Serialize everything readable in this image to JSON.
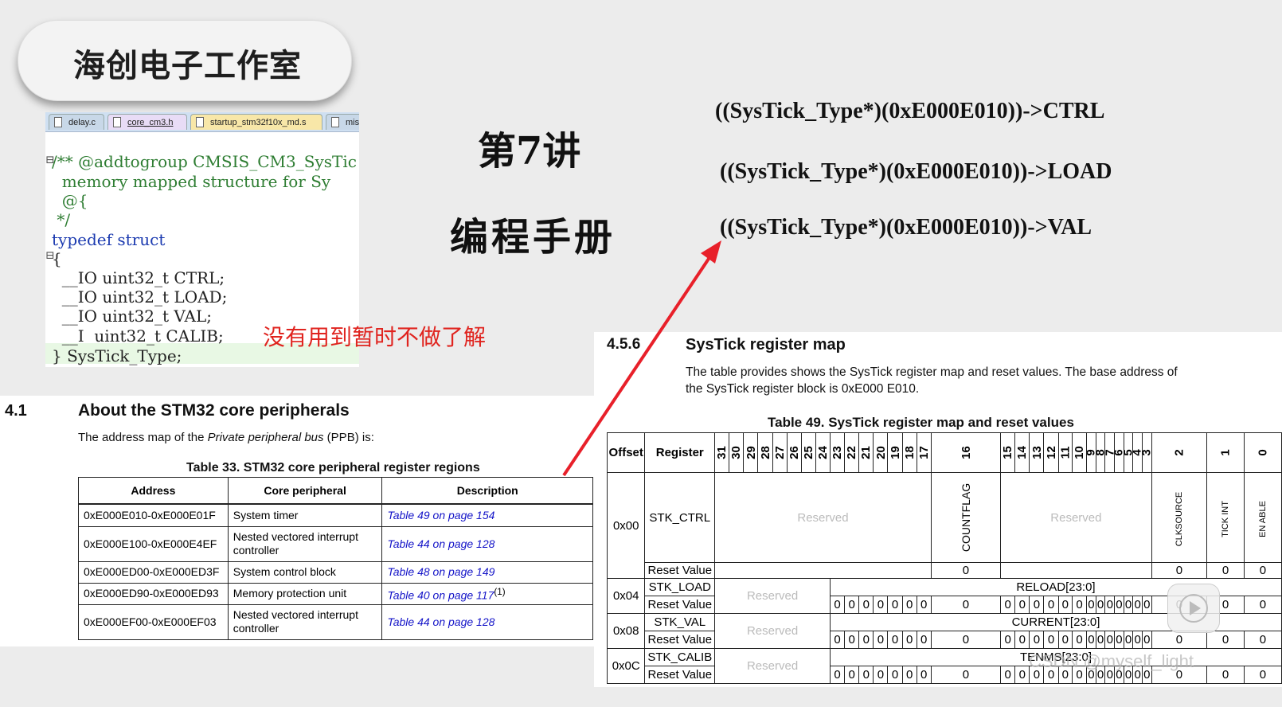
{
  "badge": {
    "title": "海创电子工作室"
  },
  "editor": {
    "tabs": [
      {
        "label": "delay.c",
        "color": "#c8d8e8"
      },
      {
        "label": "core_cm3.h",
        "color": "#e8dcf6"
      },
      {
        "label": "startup_stm32f10x_md.s",
        "color": "#f8e7a8"
      },
      {
        "label": "mis",
        "color": "#c8d8e8"
      }
    ],
    "lines": {
      "l1": "/** @addtogroup CMSIS_CM3_SysTic",
      "l2": "  memory mapped structure for Sy",
      "l3": "  @{",
      "l4": " */",
      "l5_kw": "typedef struct",
      "l6": "{",
      "l7": "  __IO uint32_t CTRL;",
      "l8": "  __IO uint32_t LOAD;",
      "l9": "  __IO uint32_t VAL;",
      "l10": "  __I  uint32_t CALIB;",
      "l11": "} SysTick_Type;"
    }
  },
  "note": "没有用到暂时不做了解",
  "lecture": "第7讲",
  "manual": "编程手册",
  "expressions": [
    "((SysTick_Type*)(0xE000E010))->CTRL",
    "((SysTick_Type*)(0xE000E010))->LOAD",
    "((SysTick_Type*)(0xE000E010))->VAL"
  ],
  "section41": {
    "number": "4.1",
    "title": "About the STM32 core peripherals",
    "para_before": "The address map of the ",
    "para_italic": "Private peripheral bus",
    "para_after": " (PPB) is:",
    "table_title": "Table 33. STM32 core peripheral register regions",
    "headers": {
      "address": "Address",
      "peripheral": "Core peripheral",
      "description": "Description"
    },
    "rows": [
      {
        "address": "0xE000E010-0xE000E01F",
        "peripheral": "System timer",
        "description": "Table 49 on page 154",
        "sup": ""
      },
      {
        "address": "0xE000E100-0xE000E4EF",
        "peripheral": "Nested vectored interrupt controller",
        "description": "Table 44 on page 128",
        "sup": ""
      },
      {
        "address": "0xE000ED00-0xE000ED3F",
        "peripheral": "System control block",
        "description": "Table 48 on page 149",
        "sup": ""
      },
      {
        "address": "0xE000ED90-0xE000ED93",
        "peripheral": "Memory protection unit",
        "description": "Table 40 on page 117",
        "sup": "(1)"
      },
      {
        "address": "0xE000EF00-0xE000EF03",
        "peripheral": "Nested vectored interrupt controller",
        "description": "Table 44 on page 128",
        "sup": ""
      }
    ]
  },
  "section456": {
    "number": "4.5.6",
    "title": "SysTick register map",
    "para1": "The table provides shows the SysTick register map and reset values. The base address of",
    "para2": "the SysTick register block is 0xE000 E010.",
    "table_title": "Table 49. SysTick register map and reset values",
    "head_offset": "Offset",
    "head_register": "Register",
    "bits": [
      "31",
      "30",
      "29",
      "28",
      "27",
      "26",
      "25",
      "24",
      "23",
      "22",
      "21",
      "20",
      "19",
      "18",
      "17",
      "16",
      "15",
      "14",
      "13",
      "12",
      "11",
      "10",
      "9",
      "8",
      "7",
      "6",
      "5",
      "4",
      "3",
      "2",
      "1",
      "0"
    ],
    "reserved": "Reserved",
    "reset_value": "Reset Value",
    "countflag": "COUNTFLAG",
    "clksource": "CLKSOURCE",
    "tickint": "TICK INT",
    "enable": "EN ABLE",
    "ctrl_reset_16": "0",
    "ctrl_reset_low": [
      "0",
      "0",
      "0"
    ],
    "reg_rows": [
      {
        "offset": "0x00",
        "name": "STK_CTRL"
      },
      {
        "offset": "0x04",
        "name": "STK_LOAD",
        "field": "RELOAD[23:0]"
      },
      {
        "offset": "0x08",
        "name": "STK_VAL",
        "field": "CURRENT[23:0]"
      },
      {
        "offset": "0x0C",
        "name": "STK_CALIB",
        "field": "TENMS[23:0]"
      }
    ]
  },
  "watermark": "CSDN @myself_light",
  "colors": {
    "arrow": "#e8202a",
    "link": "#1414c8",
    "note": "#e0241f",
    "reserved": "#bbbbbb"
  }
}
